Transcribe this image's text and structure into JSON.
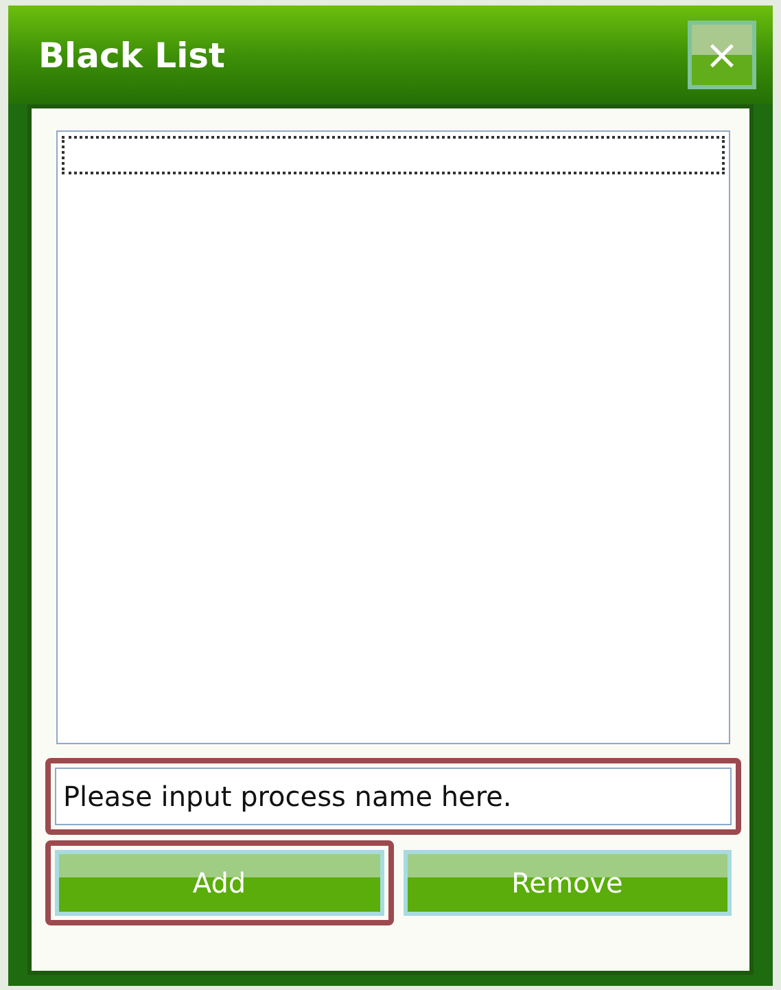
{
  "window": {
    "title": "Black List",
    "close_label": "×"
  },
  "process_list": {
    "focused_row": true
  },
  "name_field": {
    "value": "Please input process name here.",
    "highlighted": true
  },
  "buttons": [
    {
      "label": "Add",
      "highlighted": true
    },
    {
      "label": "Remove",
      "highlighted": false
    }
  ]
}
